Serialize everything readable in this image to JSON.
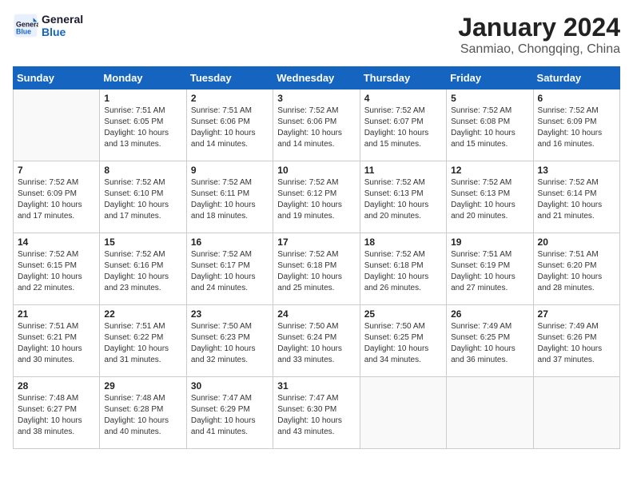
{
  "header": {
    "logo_line1": "General",
    "logo_line2": "Blue",
    "title": "January 2024",
    "subtitle": "Sanmiao, Chongqing, China"
  },
  "calendar": {
    "days_of_week": [
      "Sunday",
      "Monday",
      "Tuesday",
      "Wednesday",
      "Thursday",
      "Friday",
      "Saturday"
    ],
    "weeks": [
      [
        {
          "day": "",
          "info": ""
        },
        {
          "day": "1",
          "info": "Sunrise: 7:51 AM\nSunset: 6:05 PM\nDaylight: 10 hours\nand 13 minutes."
        },
        {
          "day": "2",
          "info": "Sunrise: 7:51 AM\nSunset: 6:06 PM\nDaylight: 10 hours\nand 14 minutes."
        },
        {
          "day": "3",
          "info": "Sunrise: 7:52 AM\nSunset: 6:06 PM\nDaylight: 10 hours\nand 14 minutes."
        },
        {
          "day": "4",
          "info": "Sunrise: 7:52 AM\nSunset: 6:07 PM\nDaylight: 10 hours\nand 15 minutes."
        },
        {
          "day": "5",
          "info": "Sunrise: 7:52 AM\nSunset: 6:08 PM\nDaylight: 10 hours\nand 15 minutes."
        },
        {
          "day": "6",
          "info": "Sunrise: 7:52 AM\nSunset: 6:09 PM\nDaylight: 10 hours\nand 16 minutes."
        }
      ],
      [
        {
          "day": "7",
          "info": "Sunrise: 7:52 AM\nSunset: 6:09 PM\nDaylight: 10 hours\nand 17 minutes."
        },
        {
          "day": "8",
          "info": "Sunrise: 7:52 AM\nSunset: 6:10 PM\nDaylight: 10 hours\nand 17 minutes."
        },
        {
          "day": "9",
          "info": "Sunrise: 7:52 AM\nSunset: 6:11 PM\nDaylight: 10 hours\nand 18 minutes."
        },
        {
          "day": "10",
          "info": "Sunrise: 7:52 AM\nSunset: 6:12 PM\nDaylight: 10 hours\nand 19 minutes."
        },
        {
          "day": "11",
          "info": "Sunrise: 7:52 AM\nSunset: 6:13 PM\nDaylight: 10 hours\nand 20 minutes."
        },
        {
          "day": "12",
          "info": "Sunrise: 7:52 AM\nSunset: 6:13 PM\nDaylight: 10 hours\nand 20 minutes."
        },
        {
          "day": "13",
          "info": "Sunrise: 7:52 AM\nSunset: 6:14 PM\nDaylight: 10 hours\nand 21 minutes."
        }
      ],
      [
        {
          "day": "14",
          "info": "Sunrise: 7:52 AM\nSunset: 6:15 PM\nDaylight: 10 hours\nand 22 minutes."
        },
        {
          "day": "15",
          "info": "Sunrise: 7:52 AM\nSunset: 6:16 PM\nDaylight: 10 hours\nand 23 minutes."
        },
        {
          "day": "16",
          "info": "Sunrise: 7:52 AM\nSunset: 6:17 PM\nDaylight: 10 hours\nand 24 minutes."
        },
        {
          "day": "17",
          "info": "Sunrise: 7:52 AM\nSunset: 6:18 PM\nDaylight: 10 hours\nand 25 minutes."
        },
        {
          "day": "18",
          "info": "Sunrise: 7:52 AM\nSunset: 6:18 PM\nDaylight: 10 hours\nand 26 minutes."
        },
        {
          "day": "19",
          "info": "Sunrise: 7:51 AM\nSunset: 6:19 PM\nDaylight: 10 hours\nand 27 minutes."
        },
        {
          "day": "20",
          "info": "Sunrise: 7:51 AM\nSunset: 6:20 PM\nDaylight: 10 hours\nand 28 minutes."
        }
      ],
      [
        {
          "day": "21",
          "info": "Sunrise: 7:51 AM\nSunset: 6:21 PM\nDaylight: 10 hours\nand 30 minutes."
        },
        {
          "day": "22",
          "info": "Sunrise: 7:51 AM\nSunset: 6:22 PM\nDaylight: 10 hours\nand 31 minutes."
        },
        {
          "day": "23",
          "info": "Sunrise: 7:50 AM\nSunset: 6:23 PM\nDaylight: 10 hours\nand 32 minutes."
        },
        {
          "day": "24",
          "info": "Sunrise: 7:50 AM\nSunset: 6:24 PM\nDaylight: 10 hours\nand 33 minutes."
        },
        {
          "day": "25",
          "info": "Sunrise: 7:50 AM\nSunset: 6:25 PM\nDaylight: 10 hours\nand 34 minutes."
        },
        {
          "day": "26",
          "info": "Sunrise: 7:49 AM\nSunset: 6:25 PM\nDaylight: 10 hours\nand 36 minutes."
        },
        {
          "day": "27",
          "info": "Sunrise: 7:49 AM\nSunset: 6:26 PM\nDaylight: 10 hours\nand 37 minutes."
        }
      ],
      [
        {
          "day": "28",
          "info": "Sunrise: 7:48 AM\nSunset: 6:27 PM\nDaylight: 10 hours\nand 38 minutes."
        },
        {
          "day": "29",
          "info": "Sunrise: 7:48 AM\nSunset: 6:28 PM\nDaylight: 10 hours\nand 40 minutes."
        },
        {
          "day": "30",
          "info": "Sunrise: 7:47 AM\nSunset: 6:29 PM\nDaylight: 10 hours\nand 41 minutes."
        },
        {
          "day": "31",
          "info": "Sunrise: 7:47 AM\nSunset: 6:30 PM\nDaylight: 10 hours\nand 43 minutes."
        },
        {
          "day": "",
          "info": ""
        },
        {
          "day": "",
          "info": ""
        },
        {
          "day": "",
          "info": ""
        }
      ]
    ]
  }
}
